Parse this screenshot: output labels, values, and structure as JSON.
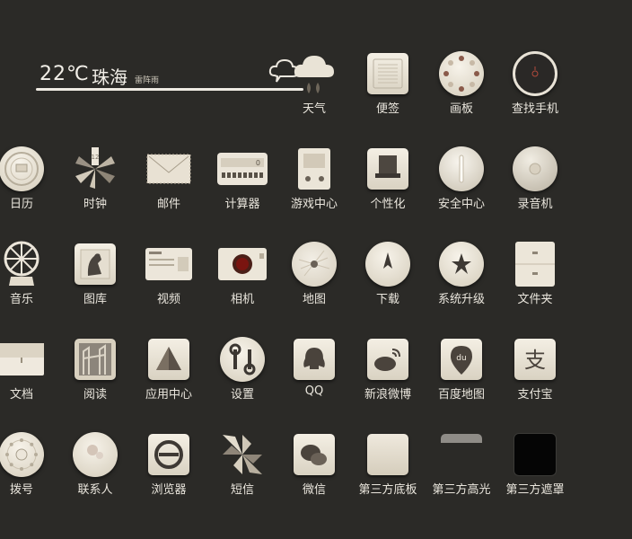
{
  "weather": {
    "temperature": "22℃",
    "city": "珠海",
    "condition": "雷阵雨"
  },
  "icons": [
    {
      "label": "天气",
      "icon": "weather-cloud-icon"
    },
    {
      "label": "便签",
      "icon": "notes-icon"
    },
    {
      "label": "画板",
      "icon": "palette-icon"
    },
    {
      "label": "查找手机",
      "icon": "find-phone-icon"
    },
    {
      "label": "日历",
      "icon": "calendar-icon"
    },
    {
      "label": "时钟",
      "icon": "clock-icon"
    },
    {
      "label": "邮件",
      "icon": "mail-icon"
    },
    {
      "label": "计算器",
      "icon": "calculator-icon"
    },
    {
      "label": "游戏中心",
      "icon": "game-center-icon"
    },
    {
      "label": "个性化",
      "icon": "personalize-icon"
    },
    {
      "label": "安全中心",
      "icon": "security-center-icon"
    },
    {
      "label": "录音机",
      "icon": "recorder-icon"
    },
    {
      "label": "音乐",
      "icon": "music-icon"
    },
    {
      "label": "图库",
      "icon": "gallery-icon"
    },
    {
      "label": "视频",
      "icon": "video-icon"
    },
    {
      "label": "相机",
      "icon": "camera-icon"
    },
    {
      "label": "地图",
      "icon": "map-icon"
    },
    {
      "label": "下载",
      "icon": "download-icon"
    },
    {
      "label": "系统升级",
      "icon": "system-update-icon"
    },
    {
      "label": "文件夹",
      "icon": "folder-icon"
    },
    {
      "label": "文档",
      "icon": "document-icon"
    },
    {
      "label": "阅读",
      "icon": "reading-icon"
    },
    {
      "label": "应用中心",
      "icon": "app-center-icon"
    },
    {
      "label": "设置",
      "icon": "settings-icon"
    },
    {
      "label": "QQ",
      "icon": "qq-icon"
    },
    {
      "label": "新浪微博",
      "icon": "weibo-icon"
    },
    {
      "label": "百度地图",
      "icon": "baidu-map-icon"
    },
    {
      "label": "支付宝",
      "icon": "alipay-icon"
    },
    {
      "label": "拨号",
      "icon": "dialer-icon"
    },
    {
      "label": "联系人",
      "icon": "contacts-icon"
    },
    {
      "label": "浏览器",
      "icon": "browser-icon"
    },
    {
      "label": "短信",
      "icon": "sms-icon"
    },
    {
      "label": "微信",
      "icon": "wechat-icon"
    },
    {
      "label": "第三方底板",
      "icon": "third-party-base-icon"
    },
    {
      "label": "第三方高光",
      "icon": "third-party-highlight-icon"
    },
    {
      "label": "第三方遮罩",
      "icon": "third-party-mask-icon"
    }
  ],
  "glyphs": {
    "calculator_display": "0",
    "baidu": "du",
    "alipay": "支"
  }
}
